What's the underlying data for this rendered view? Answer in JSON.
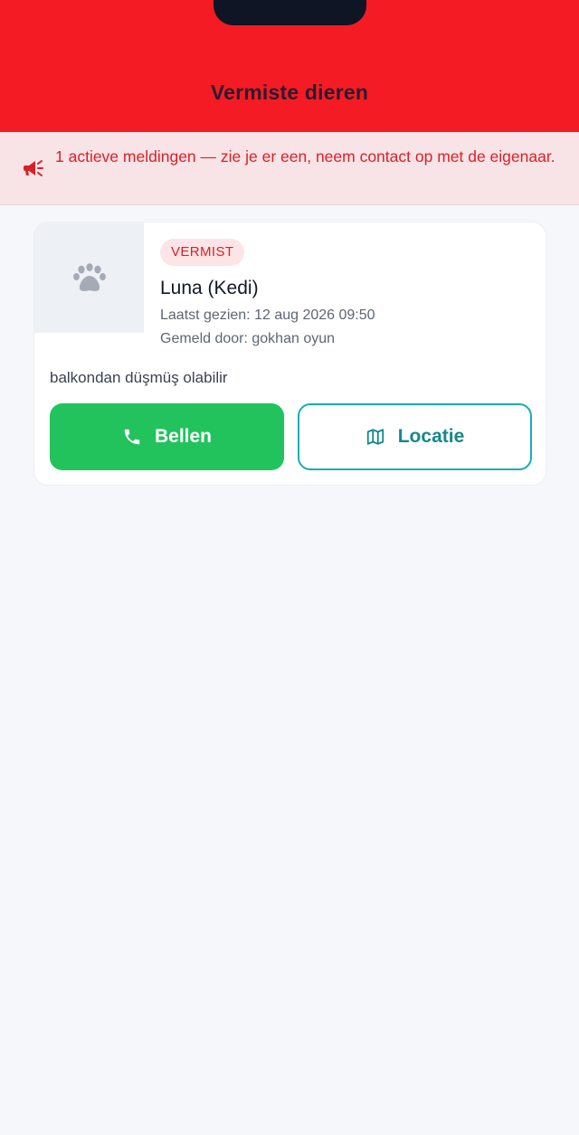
{
  "header": {
    "title": "Vermiste dieren"
  },
  "alert": {
    "icon": "megaphone-icon",
    "text": "1 actieve meldingen — zie je er een, neem contact op met de eigenaar."
  },
  "listing": {
    "photo_icon": "paw-icon",
    "status_badge": "VERMIST",
    "name": "Luna (Kedi)",
    "last_seen": "Laatst gezien: 12 aug 2026 09:50",
    "reported_by": "Gemeld door: gokhan oyun",
    "description": "balkondan düşmüş olabilir",
    "call_button": {
      "label": "Bellen",
      "icon": "phone-icon"
    },
    "location_button": {
      "label": "Locatie",
      "icon": "map-icon"
    }
  },
  "colors": {
    "header_bg": "#f51b24",
    "alert_bg": "#f8e4e7",
    "alert_text": "#dc1f27",
    "call_green": "#22c35d",
    "location_teal": "#17aeb2"
  }
}
